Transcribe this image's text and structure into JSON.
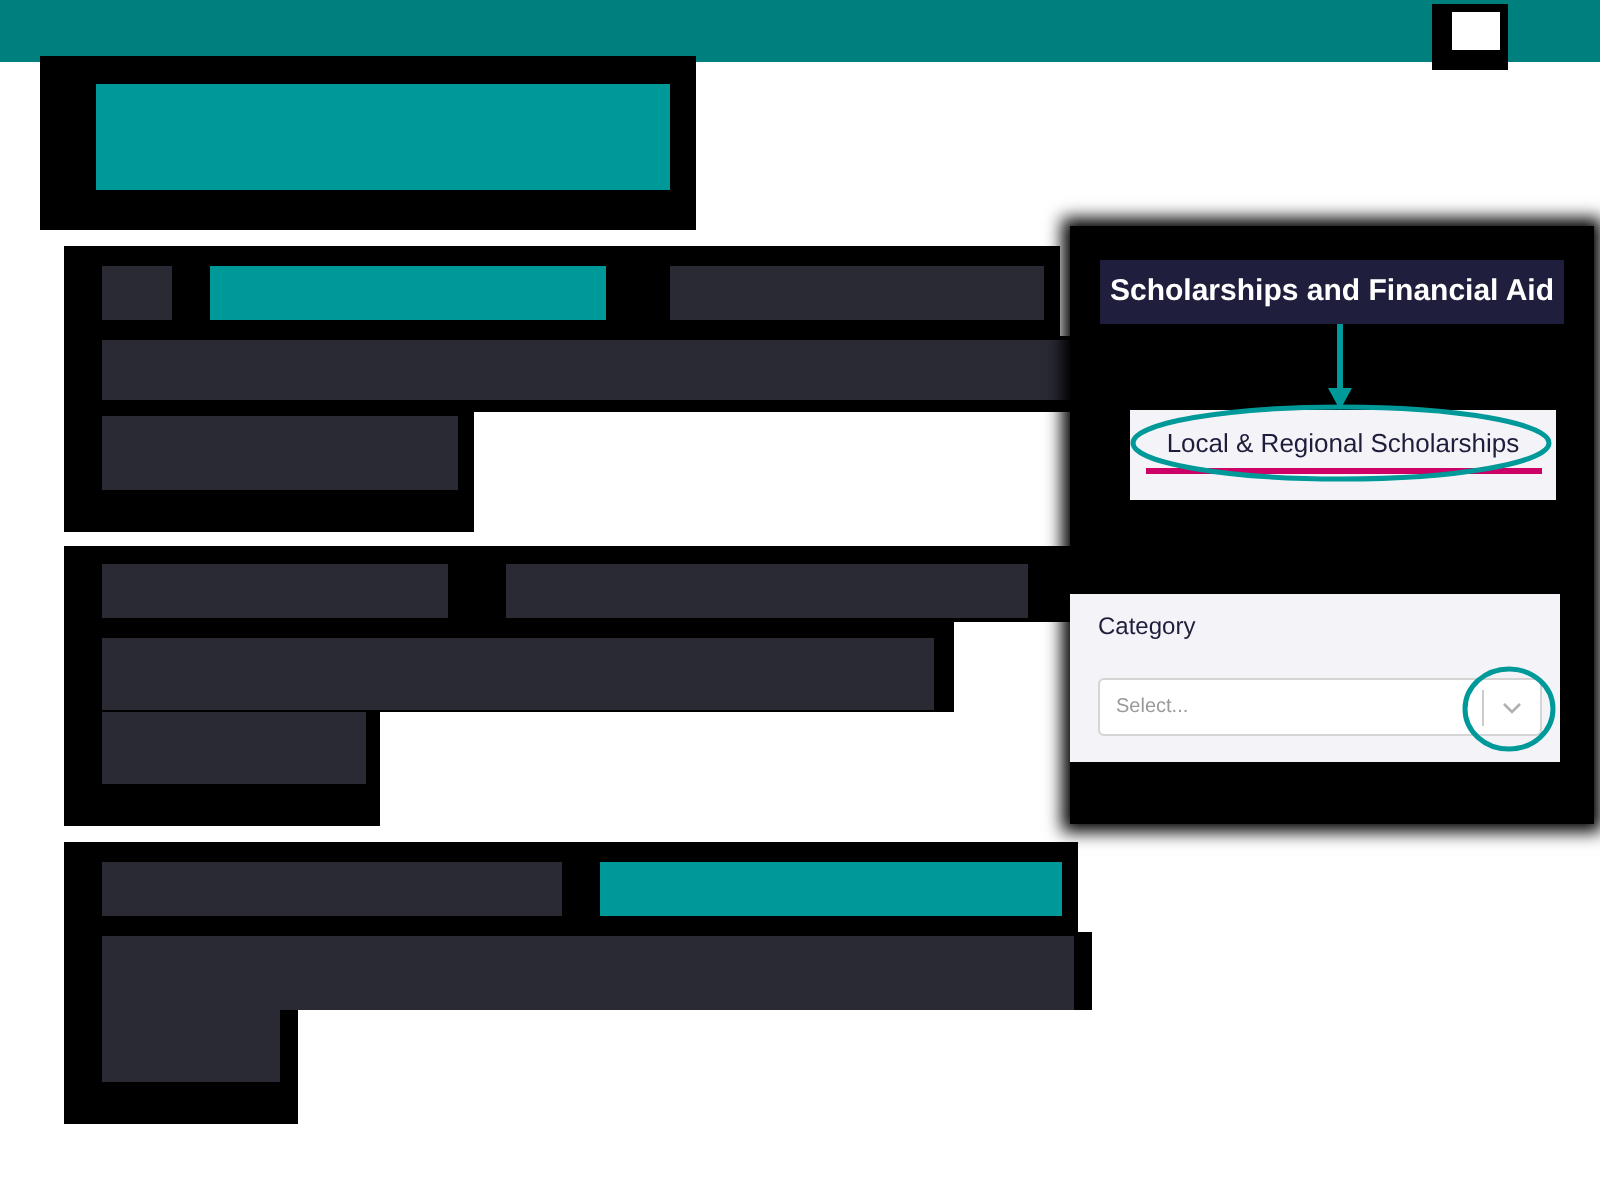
{
  "redacted_heading": {
    "kind": "accent"
  },
  "redacted_paragraphs": [
    {
      "lines": [
        {
          "segments": [
            {
              "kind": "plain"
            },
            {
              "kind": "accent"
            },
            {
              "kind": "plain"
            }
          ]
        },
        {
          "segments": [
            {
              "kind": "plain"
            }
          ]
        },
        {
          "segments": [
            {
              "kind": "plain"
            }
          ]
        }
      ]
    },
    {
      "lines": [
        {
          "segments": [
            {
              "kind": "plain"
            },
            {
              "kind": "plain"
            }
          ]
        },
        {
          "segments": [
            {
              "kind": "plain"
            }
          ]
        },
        {
          "segments": [
            {
              "kind": "plain"
            }
          ]
        }
      ]
    },
    {
      "lines": [
        {
          "segments": [
            {
              "kind": "plain"
            },
            {
              "kind": "accent"
            }
          ]
        },
        {
          "segments": [
            {
              "kind": "plain"
            }
          ]
        },
        {
          "segments": [
            {
              "kind": "plain"
            }
          ]
        }
      ]
    }
  ],
  "callout": {
    "title": "Scholarships and Financial Aid",
    "target": {
      "label": "Local & Regional Scholarships",
      "active": true
    }
  },
  "form": {
    "label": "Category",
    "select": {
      "placeholder": "Select..."
    }
  }
}
